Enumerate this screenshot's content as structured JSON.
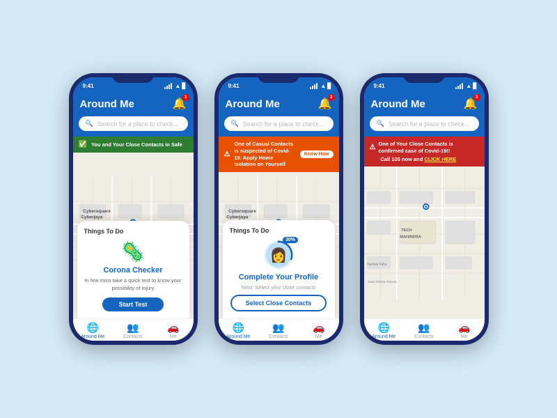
{
  "app": {
    "name": "Around Me",
    "time": "9:41",
    "notification_count": "3"
  },
  "search": {
    "placeholder": "Search for a place to check..."
  },
  "phones": [
    {
      "id": "phone1",
      "alert": {
        "type": "green",
        "icon": "✓",
        "text": "You and Your Close Contacts in Safe"
      },
      "card": {
        "type": "corona",
        "things_label": "Things To Do",
        "icon": "🦠",
        "title": "Corona Checker",
        "desc": "In few mins take a quick test to know your possibility of injury",
        "btn_label": "Start Test"
      }
    },
    {
      "id": "phone2",
      "alert": {
        "type": "yellow",
        "icon": "⚠",
        "text": "One of Casual Contacts is suspected of Covid-19. Apply Home Isolation on Yourself",
        "action": "Know How"
      },
      "card": {
        "type": "profile",
        "things_label": "Things To Do",
        "progress": "30%",
        "title": "Complete Your Profile",
        "next_label": "Next: Select your close contacts",
        "btn_label": "Select Close Contacts"
      }
    },
    {
      "id": "phone3",
      "alert": {
        "type": "red",
        "icon": "⚠",
        "text": "One of Your Close Contacts is confirmed case of Covid-19!!",
        "action": "Call 105 now and CLICK HERE"
      }
    }
  ],
  "nav": {
    "items": [
      {
        "id": "around-me",
        "icon": "🌐",
        "label": "Around Me",
        "active": true
      },
      {
        "id": "contacts",
        "icon": "👥",
        "label": "Contacts",
        "active": false
      },
      {
        "id": "me",
        "icon": "🚗",
        "label": "Me",
        "active": false
      }
    ]
  }
}
